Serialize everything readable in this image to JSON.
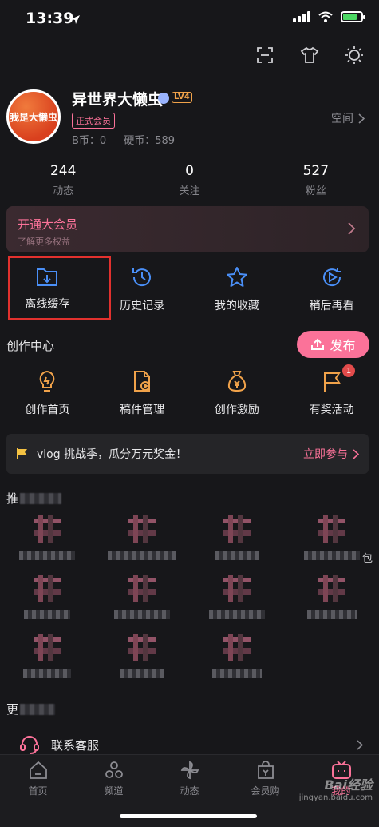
{
  "status": {
    "time": "13:39"
  },
  "profile": {
    "avatar_text": "我是大懒虫",
    "username": "异世界大懒虫",
    "level": "LV4",
    "member_tag": "正式会员",
    "space_label": "空间",
    "b_coin": "B币：0",
    "hard_coin": "硬币：589"
  },
  "stats": [
    {
      "num": "244",
      "label": "动态"
    },
    {
      "num": "0",
      "label": "关注"
    },
    {
      "num": "527",
      "label": "粉丝"
    }
  ],
  "vip": {
    "title": "开通大会员",
    "subtitle": "了解更多权益"
  },
  "quick": [
    {
      "label": "离线缓存",
      "icon": "download-folder-icon"
    },
    {
      "label": "历史记录",
      "icon": "history-clock-icon"
    },
    {
      "label": "我的收藏",
      "icon": "star-icon"
    },
    {
      "label": "稍后再看",
      "icon": "watch-later-icon"
    }
  ],
  "creation": {
    "title": "创作中心",
    "publish": "发布",
    "items": [
      {
        "label": "创作首页",
        "icon": "lightbulb-icon"
      },
      {
        "label": "稿件管理",
        "icon": "video-file-icon"
      },
      {
        "label": "创作激励",
        "icon": "money-bag-icon"
      },
      {
        "label": "有奖活动",
        "icon": "flag-icon",
        "badge": "1"
      }
    ]
  },
  "vlog": {
    "text": "vlog 挑战季，瓜分万元奖金！",
    "cta": "立即参与"
  },
  "recommend": {
    "title_start": "推",
    "extra": "包"
  },
  "more": {
    "title_start": "更"
  },
  "service": {
    "label": "联系客服"
  },
  "nav": [
    {
      "label": "首页",
      "icon": "home-icon"
    },
    {
      "label": "频道",
      "icon": "channel-icon"
    },
    {
      "label": "动态",
      "icon": "pinwheel-icon"
    },
    {
      "label": "会员购",
      "icon": "shopping-bag-icon"
    },
    {
      "label": "我的",
      "icon": "tv-icon"
    }
  ],
  "watermark": {
    "main": "Bai经验",
    "sub": "jingyan.baidu.com"
  },
  "colors": {
    "accent": "#fb7299",
    "background": "#17171a",
    "highlight_box": "#e2312e",
    "icon_blue": "#4a8ff7",
    "icon_gold": "#f0a24a"
  }
}
